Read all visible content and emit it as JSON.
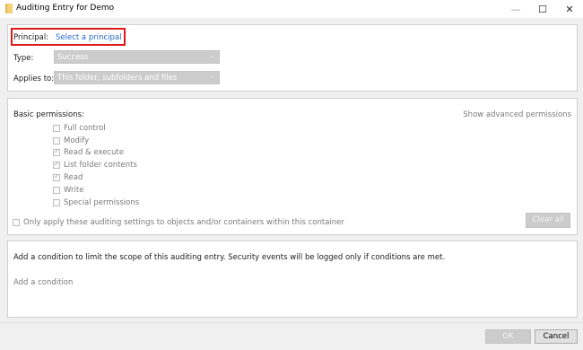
{
  "window": {
    "title": "Auditing Entry for Demo",
    "minimize_glyph": "—",
    "maximize_glyph": "☐",
    "close_glyph": "✕"
  },
  "principal": {
    "label": "Principal:",
    "link": "Select a principal"
  },
  "type": {
    "label": "Type:",
    "value": "Success"
  },
  "applies_to": {
    "label": "Applies to:",
    "value": "This folder, subfolders and files"
  },
  "basic_permissions": {
    "label": "Basic permissions:",
    "advanced_link": "Show advanced permissions",
    "items": [
      {
        "label": "Full control",
        "checked": false
      },
      {
        "label": "Modify",
        "checked": false
      },
      {
        "label": "Read & execute",
        "checked": true
      },
      {
        "label": "List folder contents",
        "checked": true
      },
      {
        "label": "Read",
        "checked": true
      },
      {
        "label": "Write",
        "checked": false
      },
      {
        "label": "Special permissions",
        "checked": false
      }
    ],
    "only_apply": "Only apply these auditing settings to objects and/or containers within this container",
    "clear_all": "Clear all"
  },
  "condition": {
    "description": "Add a condition to limit the scope of this auditing entry. Security events will be logged only if conditions are met.",
    "add_link": "Add a condition"
  },
  "footer": {
    "ok": "OK",
    "cancel": "Cancel"
  },
  "colors": {
    "highlight": "#e01818",
    "link": "#1e66c8",
    "disabled": "#cccccc"
  }
}
